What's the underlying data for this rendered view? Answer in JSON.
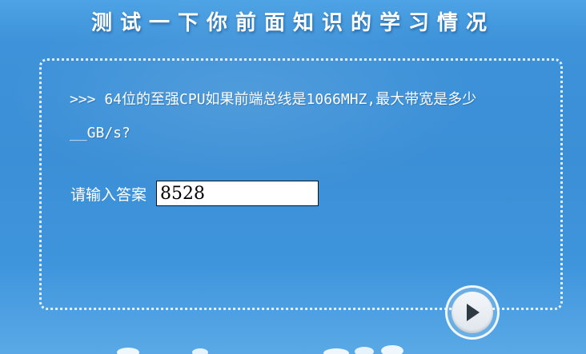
{
  "header": {
    "title": "测试一下你前面知识的学习情况"
  },
  "quiz": {
    "question_line1": ">>> 64位的至强CPU如果前端总线是1066MHZ,最大带宽是多少",
    "question_line2": "__GB/s?",
    "answer_label": "请输入答案",
    "answer_value": "8528"
  },
  "controls": {
    "play_icon": "play-icon"
  },
  "colors": {
    "background": "#3b8fd6",
    "text": "#ffffff"
  }
}
